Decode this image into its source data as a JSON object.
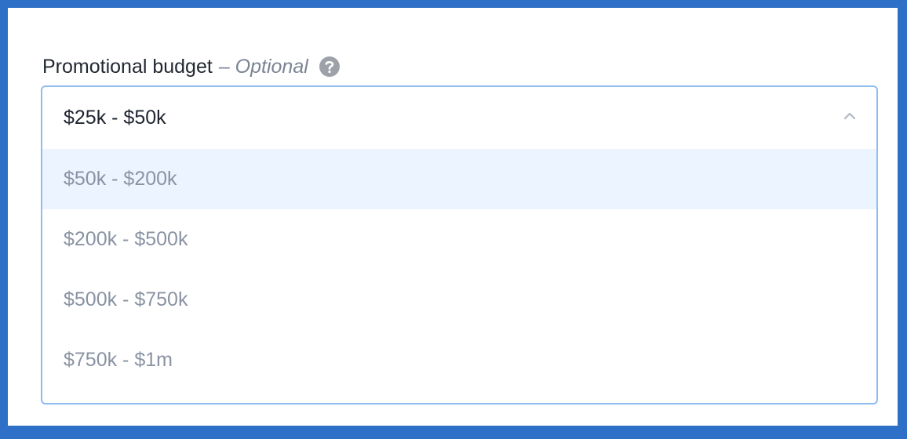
{
  "field": {
    "label": "Promotional budget",
    "optional": "– Optional",
    "help_icon": "question-circle-icon",
    "selected_value": "$25k - $50k",
    "toggle_icon": "chevron-up-icon"
  },
  "options": [
    {
      "label": "$50k - $200k",
      "highlighted": true
    },
    {
      "label": "$200k - $500k",
      "highlighted": false
    },
    {
      "label": "$500k - $750k",
      "highlighted": false
    },
    {
      "label": "$750k - $1m",
      "highlighted": false
    }
  ],
  "colors": {
    "frame_border": "#2e6fc7",
    "select_border": "#8fbdf0",
    "highlight_bg": "#ecf4ff",
    "option_text": "#8a93a3",
    "help_icon": "#9ea2a8"
  }
}
